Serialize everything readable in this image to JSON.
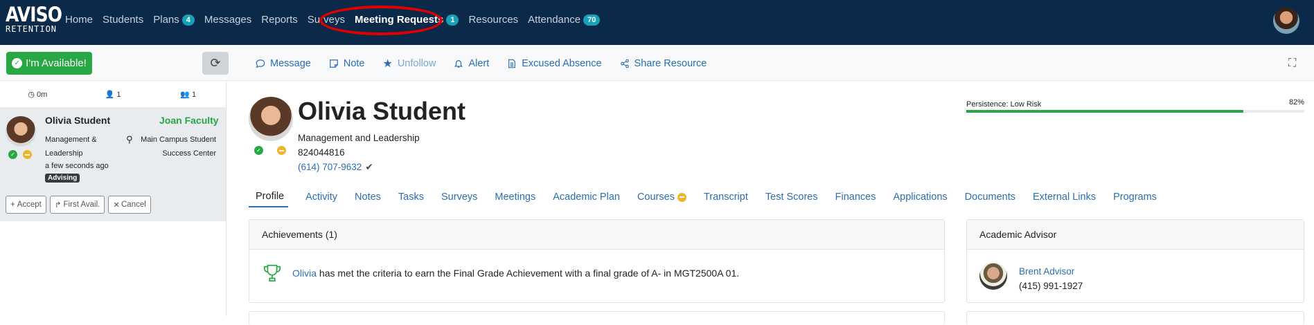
{
  "nav": {
    "logo_line1": "AVISO",
    "logo_line2": "RETENTION",
    "items": [
      {
        "label": "Home"
      },
      {
        "label": "Students"
      },
      {
        "label": "Plans",
        "badge": "4"
      },
      {
        "label": "Messages"
      },
      {
        "label": "Reports"
      },
      {
        "label": "Surveys"
      },
      {
        "label": "Meeting Requests",
        "badge": "1"
      },
      {
        "label": "Resources"
      },
      {
        "label": "Attendance",
        "badge": "70"
      }
    ]
  },
  "toolbar": {
    "available_label": "I'm Available!",
    "actions": [
      {
        "label": "Message",
        "icon": "comment-icon"
      },
      {
        "label": "Note",
        "icon": "note-icon"
      },
      {
        "label": "Unfollow",
        "icon": "star-icon"
      },
      {
        "label": "Alert",
        "icon": "bell-icon"
      },
      {
        "label": "Excused Absence",
        "icon": "document-icon"
      },
      {
        "label": "Share Resource",
        "icon": "share-icon"
      }
    ]
  },
  "queue": {
    "stats": {
      "time": "0m",
      "single": "1",
      "group": "1"
    },
    "card": {
      "name": "Olivia Student",
      "faculty": "Joan Faculty",
      "program": "Management & Leadership",
      "location": "Main Campus Student Success Center",
      "time_ago": "a few seconds ago",
      "tag": "Advising",
      "buttons": {
        "accept": "Accept",
        "first_avail": "First Avail.",
        "cancel": "Cancel"
      }
    }
  },
  "student": {
    "name": "Olivia Student",
    "program": "Management and Leadership",
    "id": "824044816",
    "phone": "(614) 707-9632"
  },
  "persistence": {
    "label": "Persistence: Low Risk",
    "value_label": "82%",
    "fraction": 0.82,
    "color": "#28a745"
  },
  "tabs": [
    "Profile",
    "Activity",
    "Notes",
    "Tasks",
    "Surveys",
    "Meetings",
    "Academic Plan",
    "Courses",
    "Transcript",
    "Test Scores",
    "Finances",
    "Applications",
    "Documents",
    "External Links",
    "Programs"
  ],
  "achievements": {
    "title": "Achievements (1)",
    "link_name": "Olivia",
    "text": " has met the criteria to earn the Final Grade Achievement with a final grade of A- in MGT2500A 01."
  },
  "advisor": {
    "title": "Academic Advisor",
    "name": "Brent Advisor",
    "phone": "(415) 991-1927"
  },
  "colors": {
    "navbar": "#0b2a4a",
    "badge": "#17a2b8",
    "success": "#28a745",
    "link": "#2a6fb3",
    "highlight": "#e10000"
  }
}
